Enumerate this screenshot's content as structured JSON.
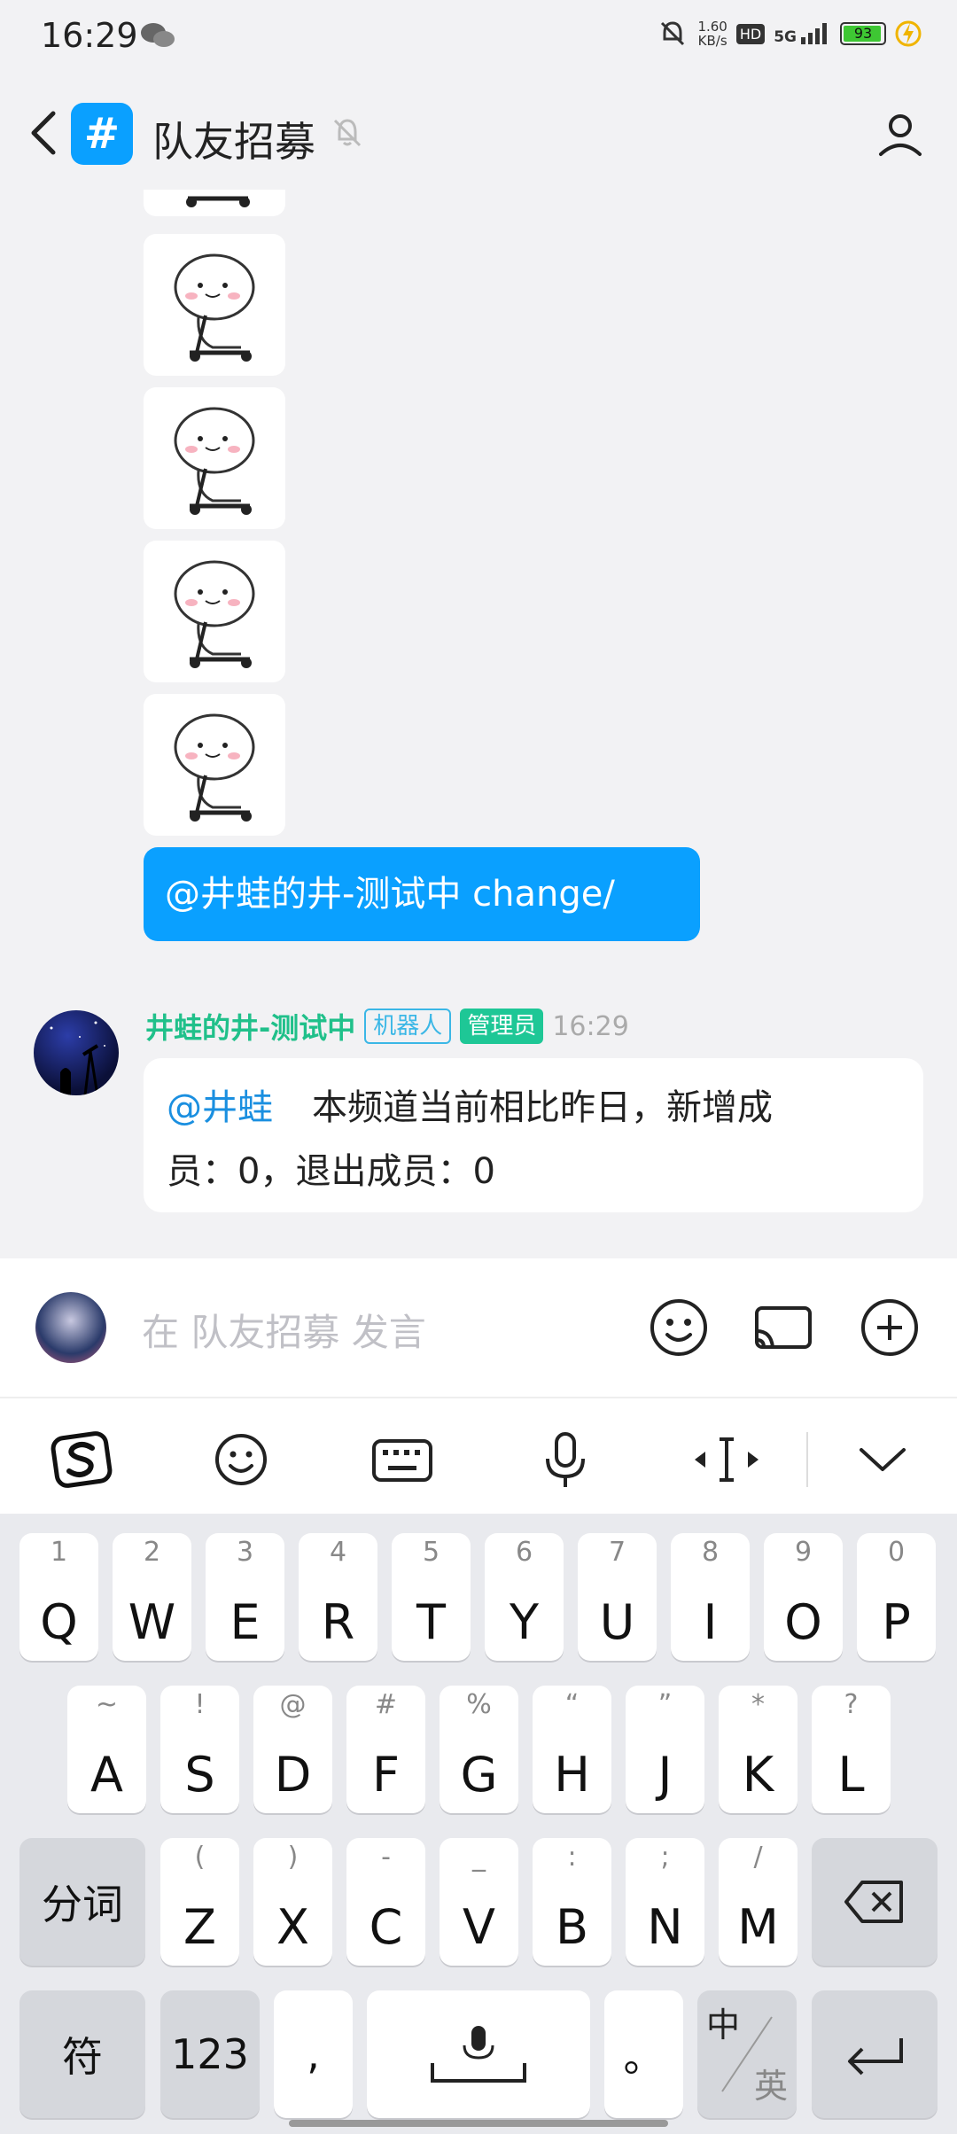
{
  "status_bar": {
    "time": "16:29",
    "net_speed_value": "1.60",
    "net_speed_unit": "KB/s",
    "hd_label": "HD",
    "signal_label": "5G",
    "battery_level": "93"
  },
  "header": {
    "channel_icon_label": "#",
    "title": "队友招募"
  },
  "chat": {
    "mention_message": "@井蛙的井-测试中  change/",
    "bot_message": {
      "sender": "井蛙的井-测试中",
      "tag_bot": "机器人",
      "tag_admin": "管理员",
      "time": "16:29",
      "mention": "@井蛙",
      "text_line1": "本频道当前相比昨日，新增成",
      "text_line2": "员：0，退出成员：0"
    }
  },
  "input": {
    "placeholder": "在  队友招募  发言"
  },
  "keyboard": {
    "row1": [
      {
        "sub": "1",
        "key": "Q"
      },
      {
        "sub": "2",
        "key": "W"
      },
      {
        "sub": "3",
        "key": "E"
      },
      {
        "sub": "4",
        "key": "R"
      },
      {
        "sub": "5",
        "key": "T"
      },
      {
        "sub": "6",
        "key": "Y"
      },
      {
        "sub": "7",
        "key": "U"
      },
      {
        "sub": "8",
        "key": "I"
      },
      {
        "sub": "9",
        "key": "O"
      },
      {
        "sub": "0",
        "key": "P"
      }
    ],
    "row2": [
      {
        "sub": "~",
        "key": "A"
      },
      {
        "sub": "!",
        "key": "S"
      },
      {
        "sub": "@",
        "key": "D"
      },
      {
        "sub": "#",
        "key": "F"
      },
      {
        "sub": "%",
        "key": "G"
      },
      {
        "sub": "“",
        "key": "H"
      },
      {
        "sub": "”",
        "key": "J"
      },
      {
        "sub": "*",
        "key": "K"
      },
      {
        "sub": "?",
        "key": "L"
      }
    ],
    "row3": [
      {
        "sub": "(",
        "key": "Z"
      },
      {
        "sub": ")",
        "key": "X"
      },
      {
        "sub": "-",
        "key": "C"
      },
      {
        "sub": "_",
        "key": "V"
      },
      {
        "sub": ":",
        "key": "B"
      },
      {
        "sub": ";",
        "key": "N"
      },
      {
        "sub": "/",
        "key": "M"
      }
    ],
    "segment_label": "分词",
    "symbol_label": "符",
    "numbers_label": "123",
    "comma_label": ",",
    "period_label": "。",
    "lang_top": "中",
    "lang_bottom": "英"
  }
}
